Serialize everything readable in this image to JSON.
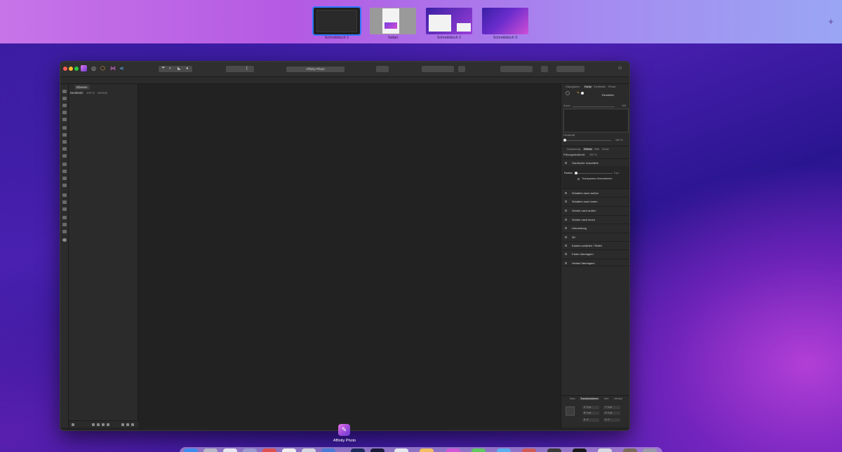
{
  "spaces": [
    {
      "label": "Schreibtisch 1",
      "active": true
    },
    {
      "label": "Safari",
      "active": false
    },
    {
      "label": "Schreibtisch 2",
      "active": false
    },
    {
      "label": "Schreibtisch 3",
      "active": false
    }
  ],
  "add_space_glyph": "+",
  "window": {
    "title": "Affinity Photo"
  },
  "left_panel": {
    "tab": "Ebenen",
    "opacity_label": "Deckkraft:",
    "opacity_value": "100 %",
    "blend_mode": "Normal"
  },
  "right_panel": {
    "top_tabs": [
      "Histogramm",
      "Farbe",
      "Farbfelder",
      "Pinsel"
    ],
    "top_tab_active": "Farbe",
    "fill_label": "Einstellen",
    "zoom_label": "Zoom",
    "zoom_value": "100",
    "opacity_label": "Deckkraft",
    "opacity_value": "100 %",
    "fx_tabs": [
      "Anpassung",
      "Effekte",
      "Stile",
      "Stock"
    ],
    "fx_tab_active": "Effekte",
    "fx_header_label": "Füllungsdeckkraft:",
    "fx_header_value": "100 %",
    "gauss": {
      "name": "Gaußsche Unschärfe",
      "radius_label": "Radius",
      "radius_value": "0 px",
      "transparency_label": "Transparenz übernehmen"
    },
    "effects": [
      "Schatten nach außen",
      "Schatten nach innen",
      "Schein nach außen",
      "Schein nach innen",
      "Umrandung",
      "3D",
      "Kanten schärfen / Relief",
      "Farbe überlagern",
      "Verlauf überlagern"
    ],
    "bottom_tabs": [
      "Navi",
      "Transformieren",
      "Info",
      "Verlauf"
    ],
    "bottom_tab_active": "Transformieren",
    "transform_fields": [
      "X: 0 px",
      "Y: 0 px",
      "B: 0 px",
      "H: 0 px",
      "R: 0°",
      "S: 0°"
    ]
  },
  "dock": {
    "app_label": "Affinity Photo"
  },
  "colors": {
    "accent": "#2f78ff",
    "traffic_red": "#ff5f57",
    "traffic_yellow": "#febc2e",
    "traffic_green": "#28c840"
  }
}
